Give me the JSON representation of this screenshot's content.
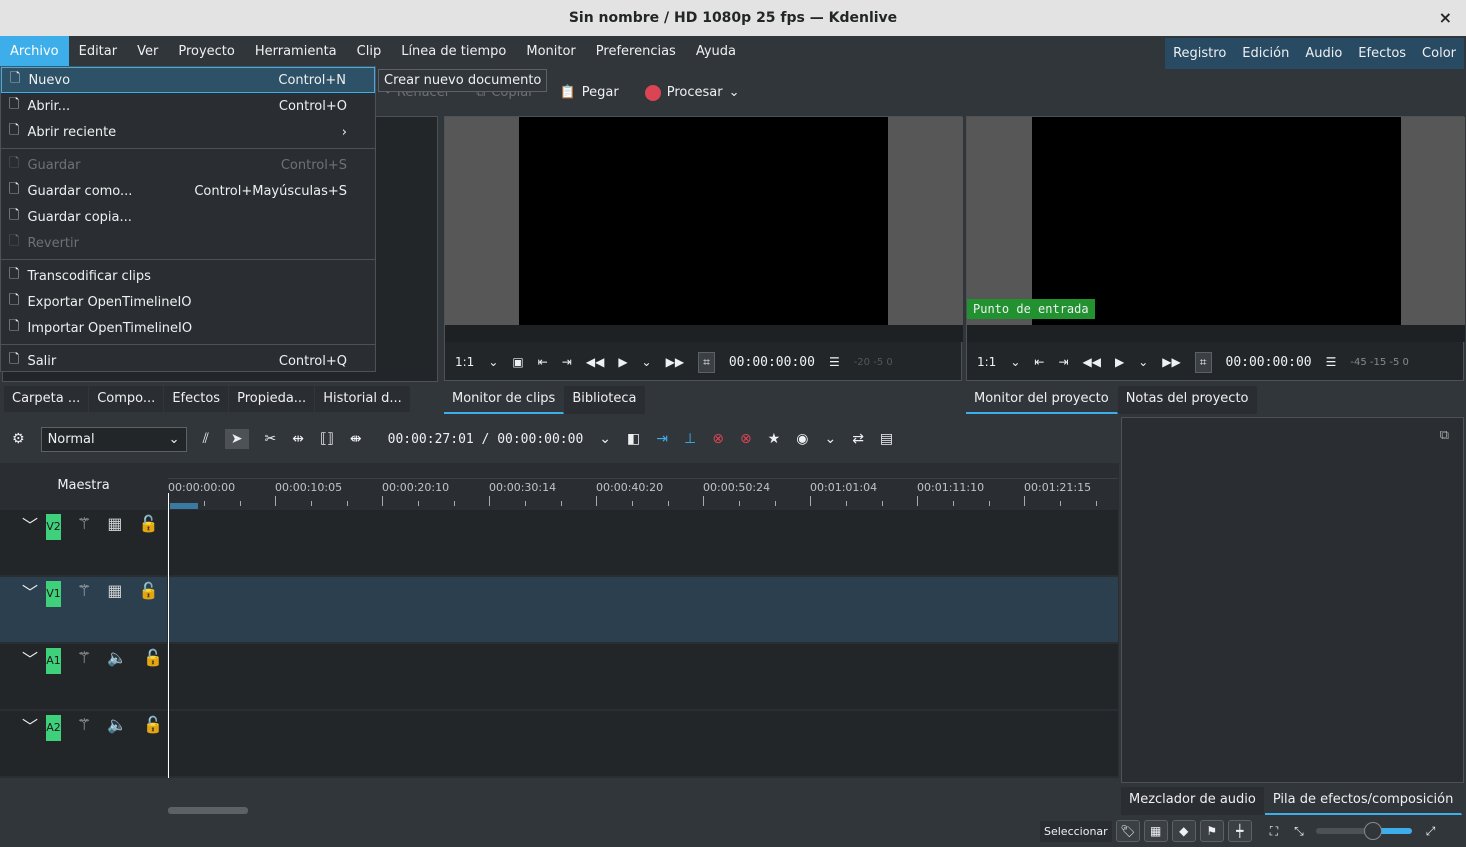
{
  "window": {
    "title": "Sin nombre / HD 1080p 25 fps — Kdenlive",
    "close": "×"
  },
  "menubar": [
    "Archivo",
    "Editar",
    "Ver",
    "Proyecto",
    "Herramienta",
    "Clip",
    "Línea de tiempo",
    "Monitor",
    "Preferencias",
    "Ayuda"
  ],
  "modes": [
    "Registro",
    "Edición",
    "Audio",
    "Efectos",
    "Color"
  ],
  "toolbar": {
    "redo": "Rehacer",
    "copy": "Copiar",
    "paste": "Pegar",
    "render": "Procesar"
  },
  "file_menu": [
    {
      "label": "Nuevo",
      "shortcut": "Control+N",
      "icon": "new-document-icon"
    },
    {
      "label": "Abrir...",
      "shortcut": "Control+O",
      "icon": "open-icon"
    },
    {
      "label": "Abrir reciente",
      "shortcut": "›",
      "icon": "recent-icon"
    },
    {
      "label": "Guardar",
      "shortcut": "Control+S",
      "icon": "save-icon",
      "disabled": true
    },
    {
      "label": "Guardar como...",
      "shortcut": "Control+Mayúsculas+S",
      "icon": "save-as-icon"
    },
    {
      "label": "Guardar copia...",
      "shortcut": "",
      "icon": "save-copy-icon"
    },
    {
      "label": "Revertir",
      "shortcut": "",
      "icon": "revert-icon",
      "disabled": true
    },
    {
      "label": "Transcodificar clips",
      "shortcut": "",
      "icon": "transcode-icon"
    },
    {
      "label": "Exportar OpenTimelineIO",
      "shortcut": "",
      "icon": "export-icon"
    },
    {
      "label": "Importar OpenTimelineIO",
      "shortcut": "",
      "icon": "import-icon"
    },
    {
      "label": "Salir",
      "shortcut": "Control+Q",
      "icon": "quit-icon"
    }
  ],
  "tooltip": "Crear nuevo documento",
  "clip_monitor": {
    "zoom": "1:1",
    "timecode": "00:00:00:00",
    "meter": "-20 -5 0"
  },
  "project_monitor": {
    "zoom": "1:1",
    "timecode": "00:00:00:00",
    "meter": "-45 -15 -5 0",
    "in_point": "Punto de entrada"
  },
  "left_tabs": [
    "Carpeta ...",
    "Compo...",
    "Efectos",
    "Propieda...",
    "Historial d..."
  ],
  "monitor_tabs": [
    "Monitor de clips",
    "Biblioteca"
  ],
  "project_tabs": [
    "Monitor del proyecto",
    "Notas del proyecto"
  ],
  "timeline": {
    "mode": "Normal",
    "timecode": "00:00:27:01 / 00:00:00:00",
    "master": "Maestra",
    "ruler": [
      "00:00:00:00",
      "00:00:10:05",
      "00:00:20:10",
      "00:00:30:14",
      "00:00:40:20",
      "00:00:50:24",
      "00:01:01:04",
      "00:01:11:10",
      "00:01:21:15"
    ],
    "tracks": [
      {
        "name": "V2",
        "type": "video"
      },
      {
        "name": "V1",
        "type": "video"
      },
      {
        "name": "A1",
        "type": "audio"
      },
      {
        "name": "A2",
        "type": "audio"
      }
    ]
  },
  "bottom_tabs": [
    "Mezclador de audio",
    "Pila de efectos/composición"
  ],
  "status": {
    "select": "Seleccionar",
    "zoom_level": 0.6
  }
}
